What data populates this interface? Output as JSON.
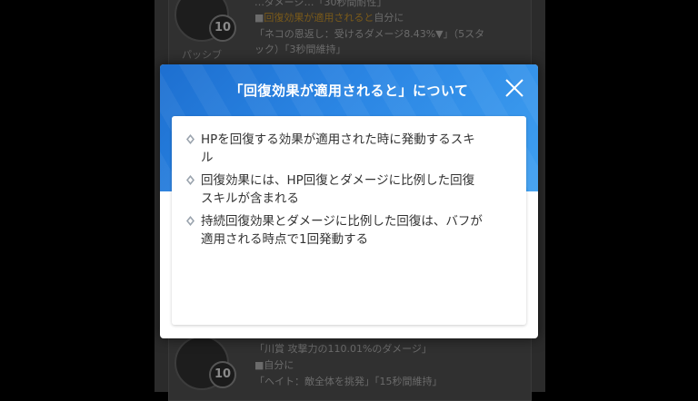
{
  "background": {
    "top_card": {
      "level": "10",
      "line1": "…ダメージ…「30秒間耐性」",
      "line2_prefix": "■",
      "line2_highlight": "回復効果が適用されると",
      "line2_suffix": "自分に",
      "line3": "「ネコの恩返し：受けるダメージ8.43%▼」（5スタ",
      "line4": "ック）「3秒間維持」",
      "label": "パッシブ"
    },
    "bottom_card": {
      "level": "10",
      "line1": "「川賞 攻撃力の110.01%のダメージ」",
      "line2": "■自分に",
      "line3": "「ヘイト：敵全体を挑発」「15秒間維持」"
    }
  },
  "modal": {
    "title": "「回復効果が適用されると」について",
    "close_icon": "close-icon",
    "bullet_icon": "diamond-bullet-icon",
    "accent_color": "#2b86e4",
    "items": [
      {
        "line1": "HPを回復する効果が適用された時に発動するスキ",
        "line2": "ル"
      },
      {
        "line1": "回復効果には、HP回復とダメージに比例した回復",
        "line2": "スキルが含まれる"
      },
      {
        "line1": "持続回復効果とダメージに比例した回復は、バフが",
        "line2": "適用される時点で1回発動する"
      }
    ]
  }
}
